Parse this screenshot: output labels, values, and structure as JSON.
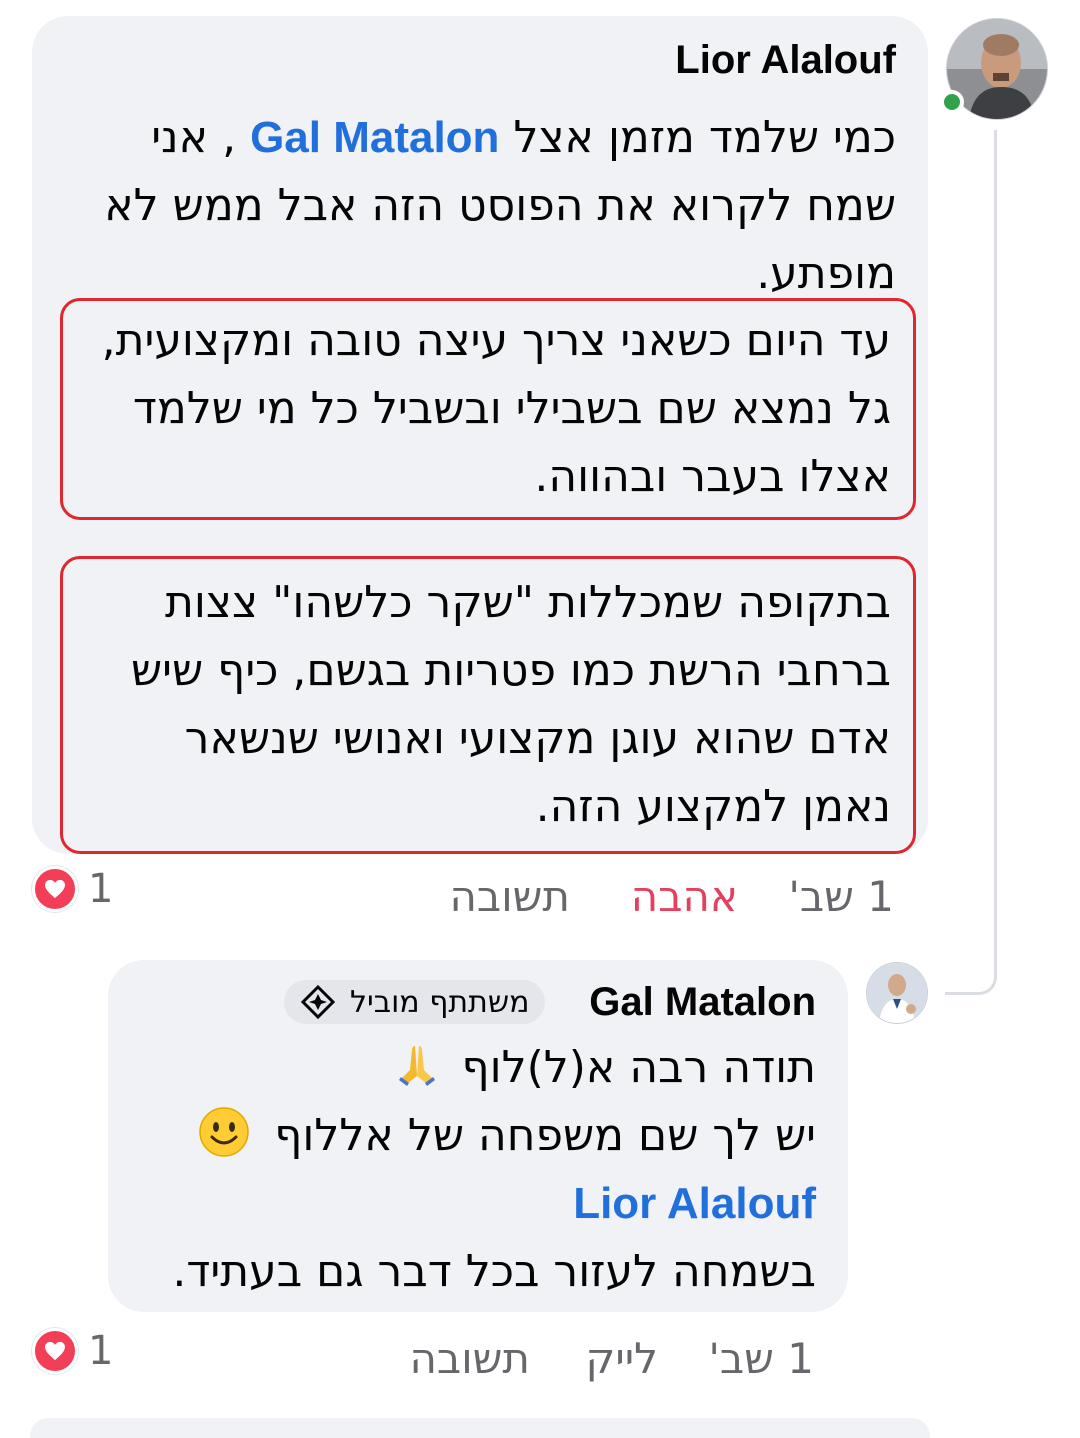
{
  "comment": {
    "author": "Lior Alalouf",
    "line1_mention": "Gal Matalon",
    "line1_pre": "כמי שלמד מזמן אצל",
    "line1_post": ", אני",
    "line2": "שמח לקרוא את הפוסט הזה אבל ממש לא",
    "line3": "מופתע.",
    "box1_lines": [
      "עד היום כשאני צריך עיצה טובה ומקצועית,",
      "גל נמצא שם בשבילי ובשביל כל מי שלמד",
      "אצלו בעבר ובהווה."
    ],
    "box2_lines": [
      "בתקופה שמכללות \"שקר כלשהו\" צצות",
      "ברחבי הרשת כמו פטריות בגשם, כיף שיש",
      "אדם שהוא עוגן מקצועי ואנושי שנשאר",
      "נאמן למקצוע הזה."
    ],
    "time": "1 שב'",
    "love_label": "אהבה",
    "reply_label": "תשובה",
    "reaction_count": "1"
  },
  "reply": {
    "author": "Gal Matalon",
    "badge": "משתתף מוביל",
    "line1": "תודה רבה א(ל)לוף",
    "line2": "יש לך שם משפחה של אללוף",
    "mention": "Lior Alalouf",
    "line4": "בשמחה לעזור בכל דבר גם בעתיד.",
    "time": "1 שב'",
    "like_label": "לייק",
    "reply_label": "תשובה",
    "reaction_count": "1"
  },
  "icons": {
    "online": "online-status-dot",
    "heart": "heart-reaction-icon",
    "badge": "top-contributor-icon",
    "pray": "folded-hands-emoji",
    "smile": "smiling-face-emoji"
  },
  "colors": {
    "bubble": "#f0f2f5",
    "mention": "#216fdb",
    "love": "#e4405f",
    "highlight": "#e0262e",
    "online": "#31a24c"
  }
}
